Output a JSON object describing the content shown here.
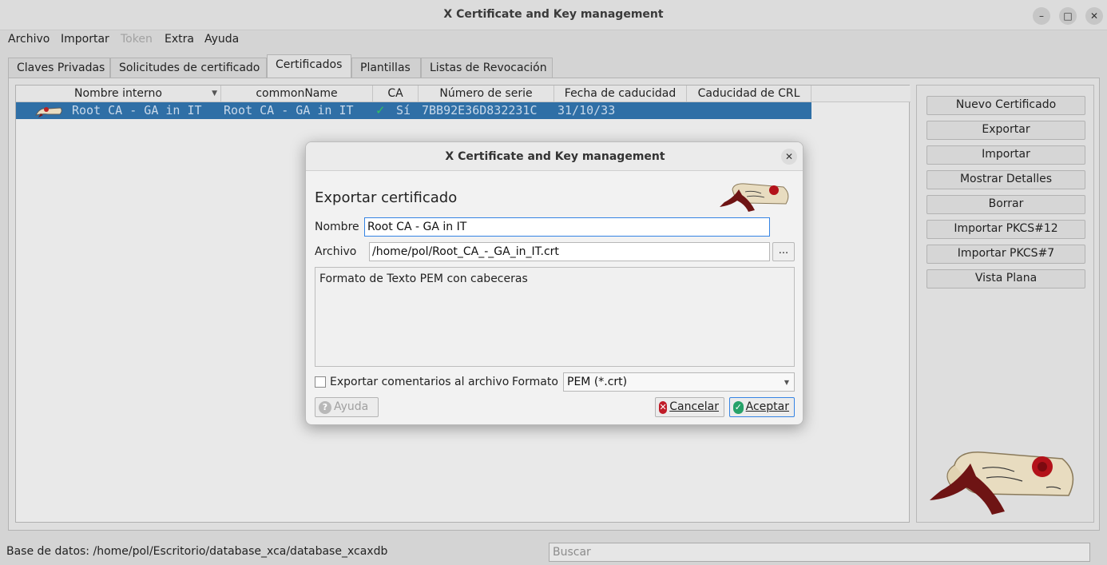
{
  "window": {
    "title": "X Certificate and Key management",
    "controls": {
      "minimize": "–",
      "maximize": "□",
      "close": "✕"
    }
  },
  "menu": [
    "Archivo",
    "Importar",
    "Token",
    "Extra",
    "Ayuda"
  ],
  "tabs": [
    "Claves Privadas",
    "Solicitudes de certificado",
    "Certificados",
    "Plantillas",
    "Listas de Revocación"
  ],
  "table": {
    "columns": [
      "Nombre interno",
      "commonName",
      "CA",
      "Número de serie",
      "Fecha de caducidad",
      "Caducidad de CRL"
    ],
    "rows": [
      {
        "internal_name": "Root CA - GA in IT",
        "common_name": "Root CA - GA in IT",
        "ca_check": "✓",
        "ca": "Sí",
        "serial": "7BB92E36D832231C",
        "expiry": "31/10/33",
        "crl_expiry": ""
      }
    ]
  },
  "buttons": [
    "Nuevo Certificado",
    "Exportar",
    "Importar",
    "Mostrar Detalles",
    "Borrar",
    "Importar PKCS#12",
    "Importar PKCS#7",
    "Vista Plana"
  ],
  "status": {
    "database": "Base de datos: /home/pol/Escritorio/database_xca/database_xcaxdb",
    "search_placeholder": "Buscar"
  },
  "dialog": {
    "title": "X Certificate and Key management",
    "close": "✕",
    "heading": "Exportar certificado",
    "name_label": "Nombre",
    "name_value": "Root CA - GA in IT",
    "file_label": "Archivo",
    "file_value": "/home/pol/Root_CA_-_GA_in_IT.crt",
    "browse_label": "...",
    "description": "Formato de Texto PEM con cabeceras",
    "export_comments_label": "Exportar comentarios al archivo",
    "format_label": "Formato",
    "format_value": "PEM (*.crt)",
    "help_label": "Ayuda",
    "cancel_label": "Cancelar",
    "accept_label": "Aceptar"
  },
  "colors": {
    "selection": "#2f6fa6",
    "accent": "#3584e4",
    "ok": "#26a269",
    "cancel": "#c01c28"
  }
}
